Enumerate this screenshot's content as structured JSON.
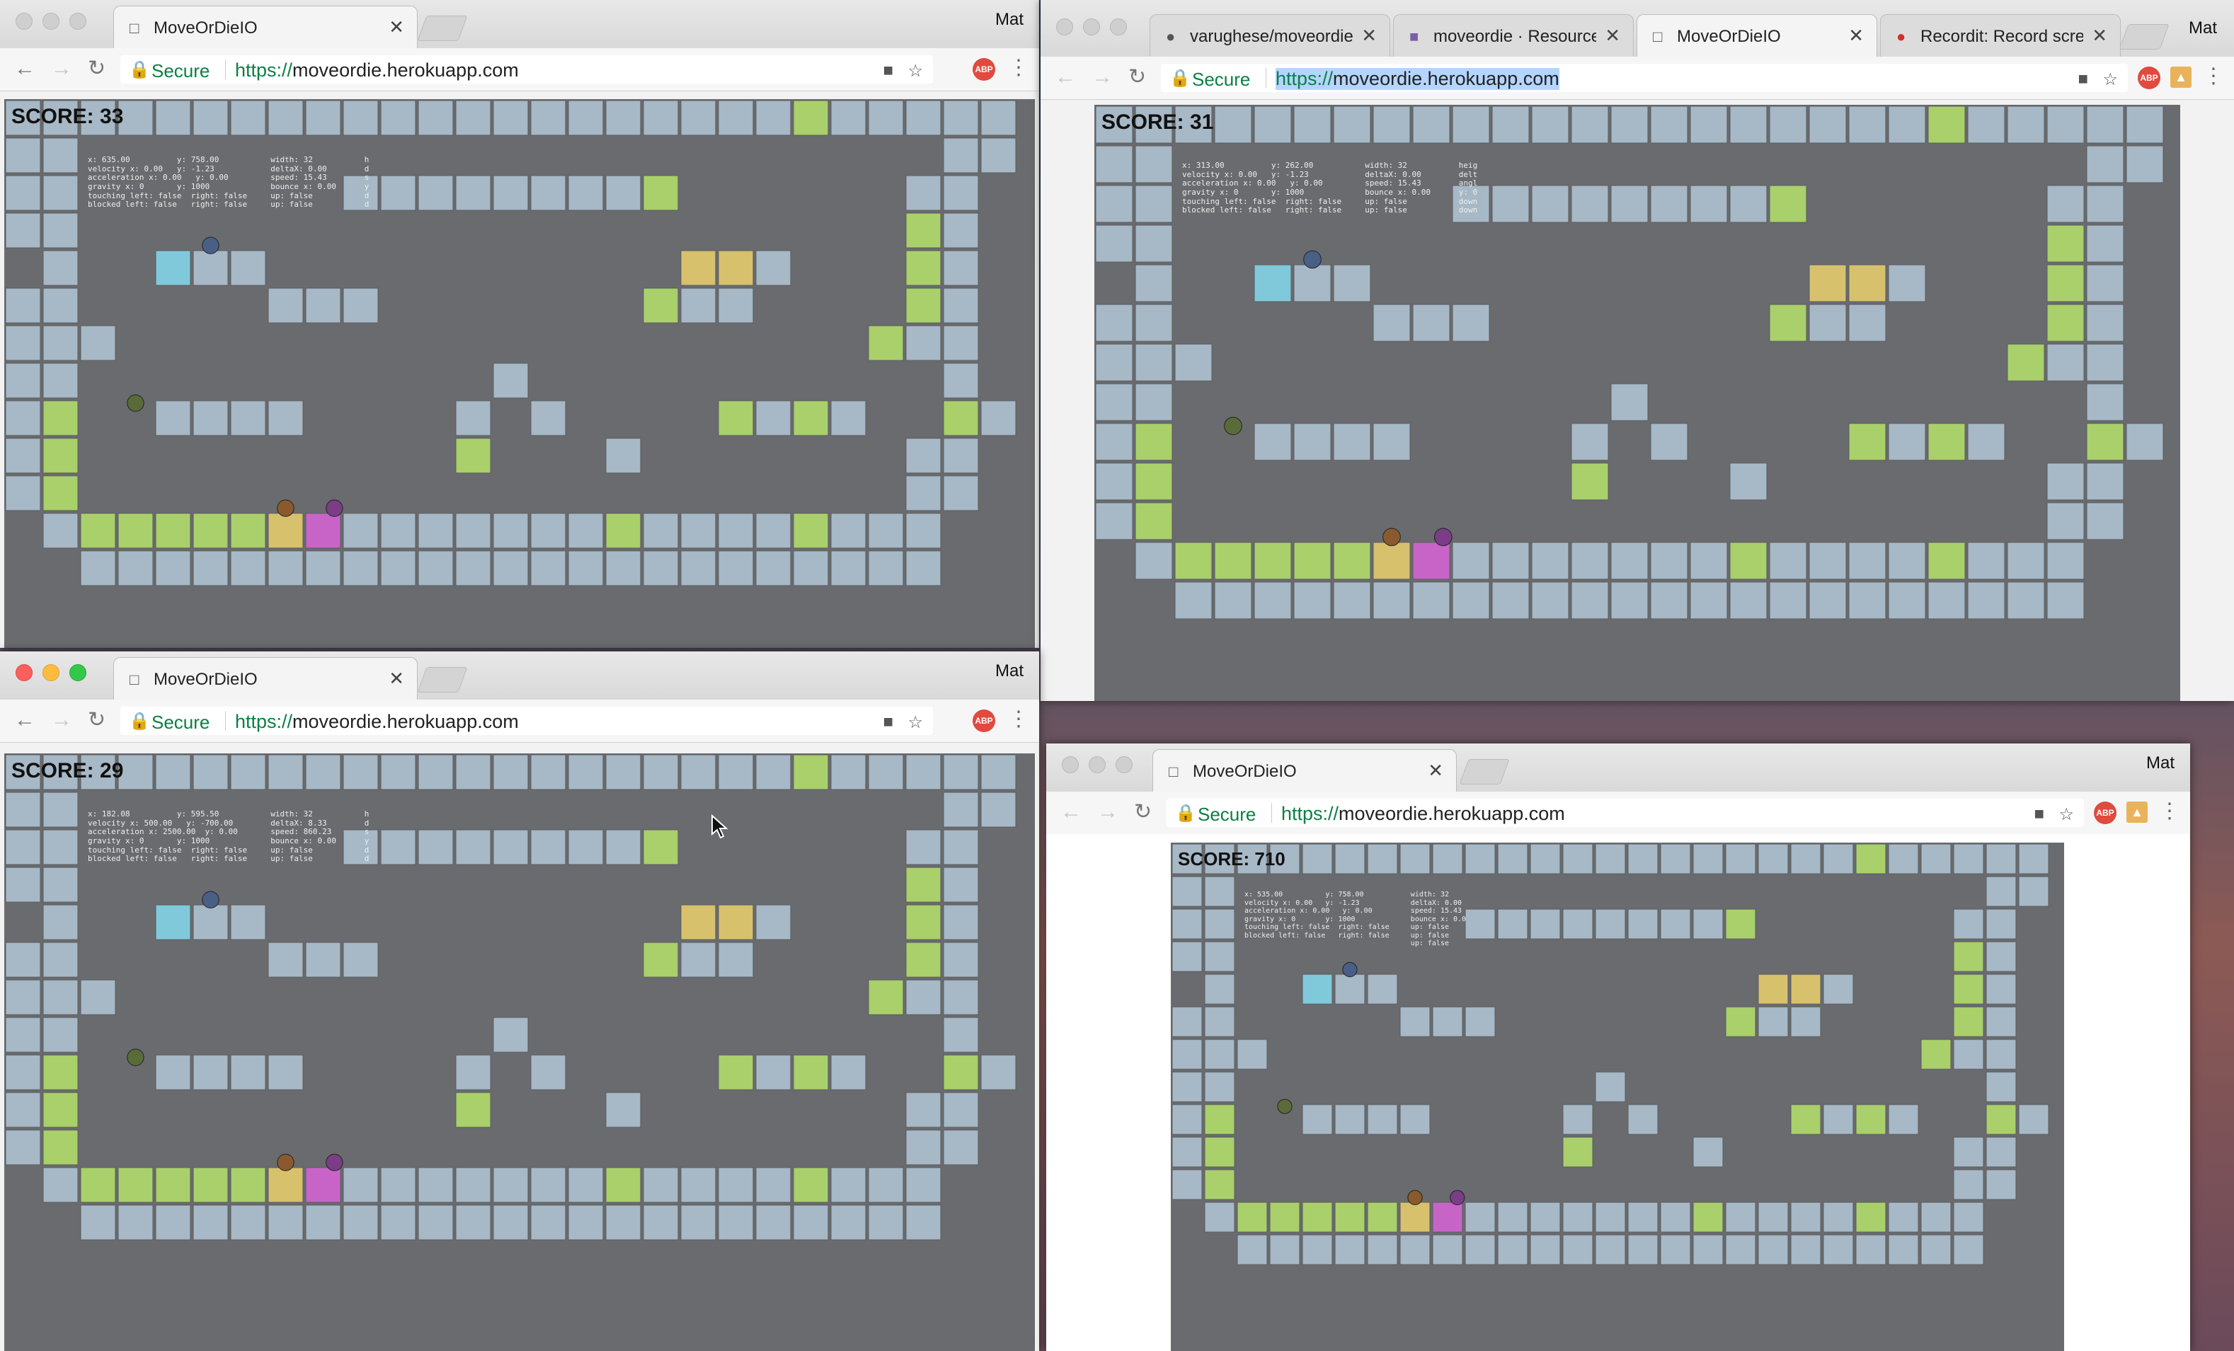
{
  "user_label": "Mat",
  "colors": {
    "wall": "#a7b8c6",
    "green": "#a9d06a",
    "yellow": "#d7c16c",
    "cyan": "#7fc9db",
    "magenta": "#c864c8",
    "game_bg": "#696b6e"
  },
  "windows": [
    {
      "id": "top-left",
      "tabs": [
        {
          "title": "MoveOrDieIO",
          "icon": "page-icon"
        }
      ],
      "omnibox": {
        "secure_label": "Secure",
        "scheme": "https://",
        "host": "moveordie.herokuapp.com"
      },
      "score": "SCORE: 33",
      "debug": [
        "x: 635.00          y: 758.00           width: 32           h\nvelocity x: 0.00   y: -1.23            deltaX: 0.00        d\nacceleration x: 0.00   y: 0.00         speed: 15.43        s\ngravity x: 0       y: 1000             bounce x: 0.00      y\ntouching left: false  right: false     up: false           d\nblocked left: false   right: false     up: false           d"
      ]
    },
    {
      "id": "top-right",
      "tabs": [
        {
          "title": "varughese/moveordie",
          "icon": "github-icon"
        },
        {
          "title": "moveordie · Resource",
          "icon": "heroku-icon"
        },
        {
          "title": "MoveOrDieIO",
          "icon": "page-icon"
        },
        {
          "title": "Recordit: Record scre",
          "icon": "record-icon"
        }
      ],
      "omnibox": {
        "secure_label": "Secure",
        "scheme": "https://",
        "host": "moveordie.herokuapp.com"
      },
      "score": "SCORE: 31",
      "debug": [
        "x: 313.00          y: 262.00           width: 32           heig\nvelocity x: 0.00   y: -1.23            deltaX: 0.00        delt\nacceleration x: 0.00   y: 0.00         speed: 15.43        angl\ngravity x: 0       y: 1000             bounce x: 0.00      y: 0\ntouching left: false  right: false     up: false           down\nblocked left: false   right: false     up: false           down"
      ]
    },
    {
      "id": "bottom-left",
      "tabs": [
        {
          "title": "MoveOrDieIO",
          "icon": "page-icon"
        }
      ],
      "omnibox": {
        "secure_label": "Secure",
        "scheme": "https://",
        "host": "moveordie.herokuapp.com"
      },
      "score": "SCORE: 29",
      "debug": [
        "x: 182.08          y: 595.50           width: 32           h\nvelocity x: 500.00   y: -700.00        deltaX: 8.33        d\nacceleration x: 2500.00  y: 0.00       speed: 860.23       s\ngravity x: 0       y: 1000             bounce x: 0.00      y\ntouching left: false  right: false     up: false           d\nblocked left: false   right: false     up: false           d"
      ]
    },
    {
      "id": "bottom-right",
      "tabs": [
        {
          "title": "MoveOrDieIO",
          "icon": "page-icon"
        }
      ],
      "omnibox": {
        "secure_label": "Secure",
        "scheme": "https://",
        "host": "moveordie.herokuapp.com"
      },
      "score": "SCORE: 710",
      "debug": [
        "x: 535.00          y: 758.00           width: 32\nvelocity x: 0.00   y: -1.23            deltaX: 0.00\nacceleration x: 0.00   y: 0.00         speed: 15.43\ngravity x: 0       y: 1000             bounce x: 0.0\ntouching left: false  right: false     up: false\nblocked left: false   right: false     up: false\n                                       up: false"
      ]
    }
  ],
  "level": {
    "cols": 27,
    "rows": 14,
    "map": [
      "WWWWWWWWWWWWWWWWWWWWWGWWWWW",
      "WW.......................WW",
      "WW.......WWWWWWWWG......WW.",
      "WW......................GW.",
      ".W..CWW...........YYW...GW.",
      "WW.....WWW.......GWW....GW.",
      "WWW....................GWW.",
      "WW...........W...........W.",
      "WG..WWWW....W.W....GWGW..GW",
      "WG..........G...W.......WW.",
      "WG......................WW.",
      ".WGGGGGYMWWWWWWWGWWWWGWWW..",
      "..WWWWWWWWWWWWWWWWWWWWWWW.."
    ]
  }
}
